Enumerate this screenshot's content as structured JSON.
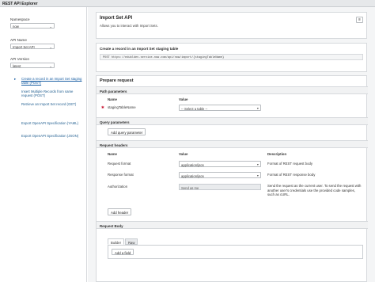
{
  "window": {
    "title": "REST API Explorer"
  },
  "sidebar": {
    "namespace_label": "Namespace",
    "namespace_value": "now",
    "api_name_label": "API Name",
    "api_name_value": "Import Set API",
    "api_version_label": "API Version",
    "api_version_value": "latest",
    "items": [
      {
        "label": "Create a record in an Import Set staging table  (POST)",
        "active": true
      },
      {
        "label": "Insert Multiple Records from same request  (POST)"
      },
      {
        "label": "Retrieve an Import Set record  (GET)"
      },
      {
        "label": "Export OpenAPI Specification (YAML)"
      },
      {
        "label": "Export OpenAPI Specification (JSON)"
      }
    ]
  },
  "main": {
    "title": "Import Set API",
    "subtitle": "Allows you to interact with Import Sets.",
    "menu_icon": "hamburger-icon",
    "endpoint_title": "Create a record in an Import Set staging table",
    "endpoint_url": "POST  https://edubldev.service-now.com/api/now/import/{stagingTableName}",
    "prepare_title": "Prepare request",
    "path_params": {
      "label": "Path parameters",
      "col_name": "Name",
      "col_value": "Value",
      "rows": [
        {
          "name": "stagingTableName",
          "value": "-- Select a table --",
          "required_mark": "✱"
        }
      ]
    },
    "query_params": {
      "label": "Query parameters",
      "add_button": "Add query parameter"
    },
    "request_headers": {
      "label": "Request headers",
      "col_name": "Name",
      "col_value": "Value",
      "col_desc": "Description",
      "rows": [
        {
          "name": "Request format",
          "value": "application/json",
          "desc": "Format of REST request body"
        },
        {
          "name": "Response format",
          "value": "application/json",
          "desc": "Format of REST response body"
        },
        {
          "name": "Authorization",
          "value": "Send as me",
          "desc": "Send the request as the current user. To send the request with another user's credentials use the provided code samples, such as cURL."
        }
      ],
      "add_button": "Add header"
    },
    "request_body": {
      "label": "Request Body",
      "tabs": [
        "Builder",
        "Raw"
      ],
      "add_field": "Add a field"
    }
  },
  "colors": {
    "link": "#1a5fa3",
    "required": "#c8102e",
    "page_bg": "#f4f5f6"
  }
}
